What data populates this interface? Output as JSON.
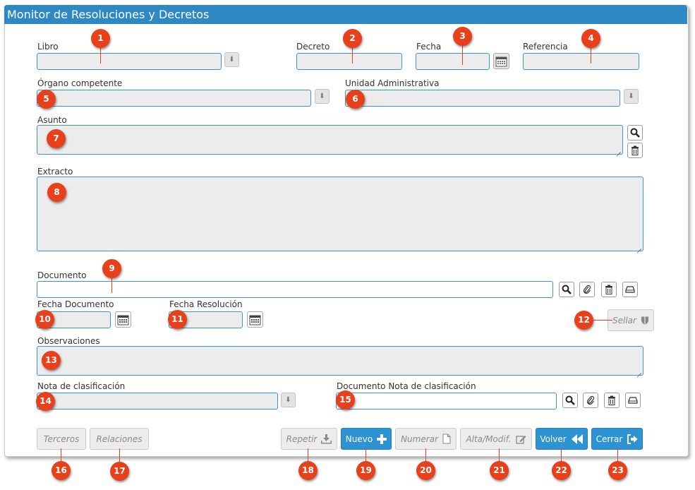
{
  "window": {
    "title": "Monitor de Resoluciones y Decretos"
  },
  "fields": {
    "libro": {
      "label": "Libro",
      "value": ""
    },
    "decreto": {
      "label": "Decreto",
      "value": ""
    },
    "fecha": {
      "label": "Fecha",
      "value": ""
    },
    "referencia": {
      "label": "Referencia",
      "value": ""
    },
    "organo": {
      "label": "Órgano competente",
      "value": ""
    },
    "unidad": {
      "label": "Unidad Administrativa",
      "value": ""
    },
    "asunto": {
      "label": "Asunto",
      "value": ""
    },
    "extracto": {
      "label": "Extracto",
      "value": ""
    },
    "documento": {
      "label": "Documento",
      "value": ""
    },
    "fecha_documento": {
      "label": "Fecha Documento",
      "value": ""
    },
    "fecha_resolucion": {
      "label": "Fecha Resolución",
      "value": ""
    },
    "observaciones": {
      "label": "Observaciones",
      "value": ""
    },
    "nota": {
      "label": "Nota de clasificación",
      "value": ""
    },
    "doc_nota": {
      "label": "Documento Nota de clasificación",
      "value": ""
    }
  },
  "buttons": {
    "sellar": "Sellar",
    "terceros": "Terceros",
    "relaciones": "Relaciones",
    "repetir": "Repetir",
    "nuevo": "Nuevo",
    "numerar": "Numerar",
    "alta": "Alta/Modif.",
    "volver": "Volver",
    "cerrar": "Cerrar"
  },
  "callouts": [
    "1",
    "2",
    "3",
    "4",
    "5",
    "6",
    "7",
    "8",
    "9",
    "10",
    "11",
    "12",
    "13",
    "14",
    "15",
    "16",
    "17",
    "18",
    "19",
    "20",
    "21",
    "22",
    "23"
  ],
  "colors": {
    "titlebar": "#2e88c4",
    "field_border": "#3b97c9",
    "primary_button": "#2e93d3",
    "callout": "#e8401a"
  },
  "icons": {
    "dropdown": "arrow-down-icon",
    "calendar": "calendar-icon",
    "search": "search-icon",
    "delete": "trash-icon",
    "attach": "paperclip-icon",
    "scan": "scanner-icon",
    "seal": "shield-icon",
    "repeat": "download-icon",
    "new": "plus-icon",
    "number": "document-icon",
    "edit": "edit-icon",
    "back": "rewind-icon",
    "close": "exit-icon"
  }
}
